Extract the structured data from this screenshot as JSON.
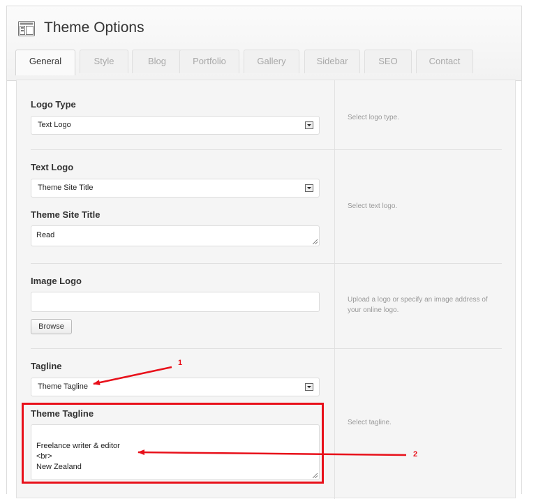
{
  "page": {
    "title": "Theme Options",
    "icon": "theme-options-icon"
  },
  "tabs": [
    {
      "label": "General",
      "active": true
    },
    {
      "label": "Style"
    },
    {
      "label": "Blog"
    },
    {
      "label": "Portfolio"
    },
    {
      "label": "Gallery"
    },
    {
      "label": "Sidebar"
    },
    {
      "label": "SEO"
    },
    {
      "label": "Contact"
    }
  ],
  "sections": {
    "logo_type": {
      "label": "Logo Type",
      "value": "Text Logo",
      "description": "Select logo type."
    },
    "text_logo": {
      "label": "Text Logo",
      "value": "Theme Site Title",
      "description": "Select text logo."
    },
    "site_title": {
      "label": "Theme Site Title",
      "value": "Read"
    },
    "image_logo": {
      "label": "Image Logo",
      "value": "",
      "browse_label": "Browse",
      "description": "Upload a logo or specify an image address of your online logo."
    },
    "tagline": {
      "label": "Tagline",
      "value": "Theme Tagline",
      "description": "Select tagline."
    },
    "theme_tagline": {
      "label": "Theme Tagline",
      "value": "Freelance writer & editor\n<br>\nNew Zealand"
    }
  },
  "annotations": {
    "callout_1": "1",
    "callout_2": "2",
    "color": "#e8101a"
  }
}
